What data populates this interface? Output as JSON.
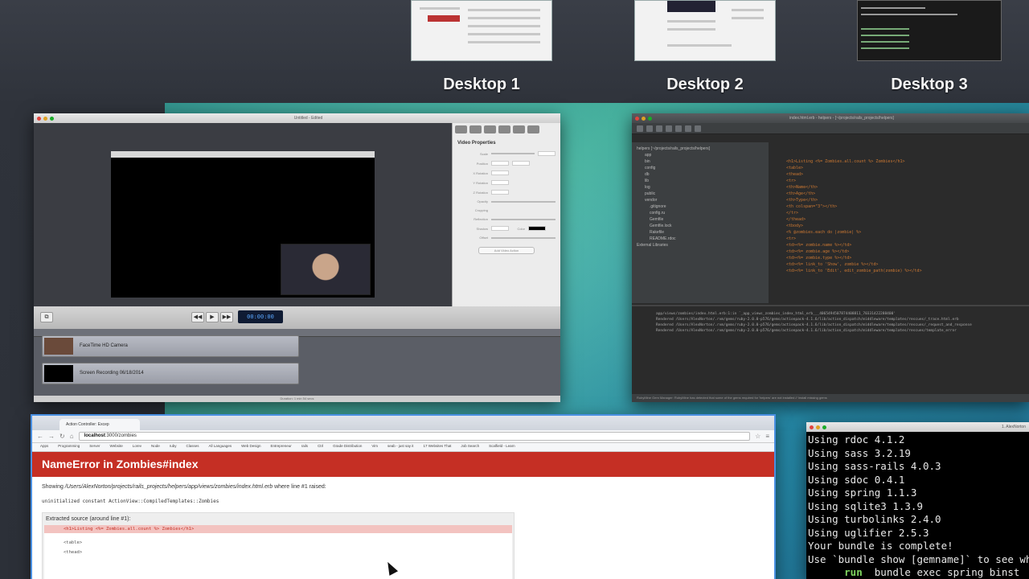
{
  "spaces": [
    {
      "label": "Desktop 1"
    },
    {
      "label": "Desktop 2"
    },
    {
      "label": "Desktop 3"
    }
  ],
  "screenflow": {
    "title": "Untitled - Edited",
    "properties_title": "Video Properties",
    "prop_labels": [
      "Scale",
      "Position",
      "X Rotation",
      "Y Rotation",
      "Z Rotation",
      "Opacity",
      "Cropping",
      "Reflection",
      "Shadow",
      "Offset"
    ],
    "color_label": "Color",
    "add_action": "Add Video Action",
    "timecode": "00:00:00",
    "tracks": [
      {
        "label": "FaceTime HD Camera"
      },
      {
        "label": "Screen Recording 06/18/2014"
      }
    ],
    "duration_status": "Duration: 1 min 54 secs"
  },
  "rubymine": {
    "title": "index.html.erb - helpers - [~/projects/rails_projects/helpers]",
    "tree": [
      "helpers [~/projects/rails_projects/helpers]",
      "app",
      "bin",
      "config",
      "db",
      "lib",
      "log",
      "public",
      "vendor",
      ".gitignore",
      "config.ru",
      "Gemfile",
      "Gemfile.lock",
      "Rakefile",
      "README.rdoc",
      "External Libraries"
    ],
    "code": [
      "<h1>Listing <%= Zombies.all.count %> Zombies</h1>",
      "",
      "<table>",
      "  <thead>",
      "    <tr>",
      "      <th>Name</th>",
      "      <th>Age</th>",
      "      <th>Type</th>",
      "      <th colspan=\"3\"></th>",
      "    </tr>",
      "  </thead>",
      "",
      "  <tbody>",
      "    <% @zombies.each do |zombie| %>",
      "      <tr>",
      "        <td><%= zombie.name %></td>",
      "        <td><%= zombie.age %></td>",
      "        <td><%= zombie.type %></td>",
      "        <td><%= link_to 'Show', zombie %></td>",
      "        <td><%= link_to 'Edit', edit_zombie_path(zombie) %></td>"
    ],
    "terminal": [
      "app/views/zombies/index.html.erb:1:in `_app_views_zombies_index_html_erb___4065494507874408811_70331422288400'",
      "",
      "Rendered /Users/AlexNorton/.rvm/gems/ruby-2.0.0-p576/gems/actionpack-4.1.6/lib/action_dispatch/middleware/templates/rescues/_trace.html.erb",
      "Rendered /Users/AlexNorton/.rvm/gems/ruby-2.0.0-p576/gems/actionpack-4.1.6/lib/action_dispatch/middleware/templates/rescues/_request_and_response",
      "Rendered /Users/AlexNorton/.rvm/gems/ruby-2.0.0-p576/gems/actionpack-4.1.6/lib/action_dispatch/middleware/templates/rescues/template_error"
    ],
    "status": "RubyMine Gem Manager: RubyMine has detected that some of the gems required for 'helpers' are not installed // Install missing gems"
  },
  "browser": {
    "tab_title": "Action Controller: Excep",
    "url_host": "localhost",
    "url_path": ":3000/zombies",
    "bookmarks": [
      "Apps",
      "Programming",
      "Server",
      "Website",
      "Lorev",
      "Node",
      "ruby",
      "Classes",
      "All Languages",
      "Web Design",
      "Entrepreneur",
      "rails",
      "Ctrl",
      "Grade Distribution",
      "Vim",
      "seab - just say it",
      "17 Websites That",
      "Job Search",
      "Scalfield - Learn"
    ],
    "error_title": "NameError in Zombies#index",
    "showing_prefix": "Showing ",
    "showing_path": "/Users/AlexNorton/projects/rails_projects/helpers/app/views/zombies/index.html.erb",
    "showing_suffix": " where line #1 raised:",
    "uninit": "uninitialized constant ActionView::CompiledTemplates::Zombies",
    "source_header": "Extracted source (around line #1):",
    "source_lines": [
      "<h1>Listing <%= Zombies.all.count %> Zombies</h1>",
      "",
      "<table>",
      "  <thead>"
    ]
  },
  "terminal": {
    "title": "1. AlexNorton",
    "lines": [
      "Using rdoc 4.1.2",
      "Using sass 3.2.19",
      "Using sass-rails 4.0.3",
      "Using sdoc 0.4.1",
      "Using spring 1.1.3",
      "Using sqlite3 1.3.9",
      "Using turbolinks 2.4.0",
      "Using uglifier 2.5.3",
      "Your bundle is complete!",
      "Use `bundle show [gemname]` to see whe"
    ],
    "run_word": "run",
    "run_rest": "  bundle exec spring binst"
  },
  "colors": {
    "error_red": "#c52f24",
    "terminal_green": "#7fd45f"
  }
}
